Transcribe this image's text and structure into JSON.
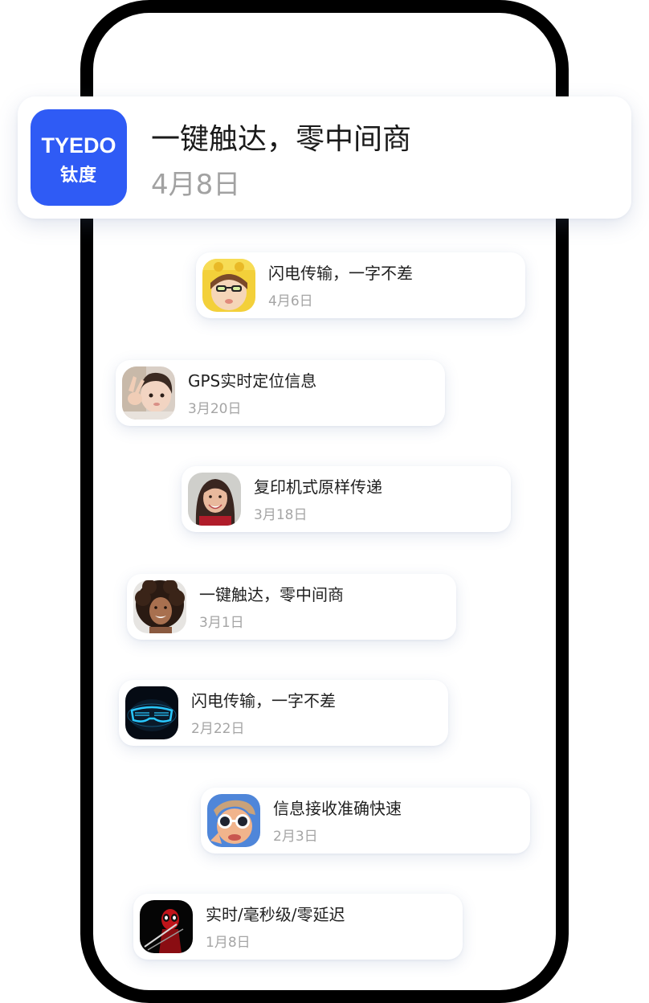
{
  "hero": {
    "logo_en": "TYEDO",
    "logo_cn": "钛度",
    "title": "一键触达，零中间商",
    "date": "4月8日"
  },
  "messages": [
    {
      "title": "闪电传输，一字不差",
      "date": "4月6日",
      "icon": "child-yellow-hood-avatar"
    },
    {
      "title": "GPS实时定位信息",
      "date": "3月20日",
      "icon": "child-peace-sign-avatar"
    },
    {
      "title": "复印机式原样传递",
      "date": "3月18日",
      "icon": "smiling-woman-avatar"
    },
    {
      "title": "一键触达，零中间商",
      "date": "3月1日",
      "icon": "curly-hair-woman-avatar"
    },
    {
      "title": "闪电传输，一字不差",
      "date": "2月22日",
      "icon": "neon-glasses-avatar"
    },
    {
      "title": "信息接收准确快速",
      "date": "2月3日",
      "icon": "sunglasses-man-avatar"
    },
    {
      "title": "实时/毫秒级/零延迟",
      "date": "1月8日",
      "icon": "masked-hero-avatar"
    }
  ],
  "colors": {
    "brand_blue": "#2f5bf5",
    "phone_frame": "#000000",
    "date_gray": "#a5a5a5"
  }
}
